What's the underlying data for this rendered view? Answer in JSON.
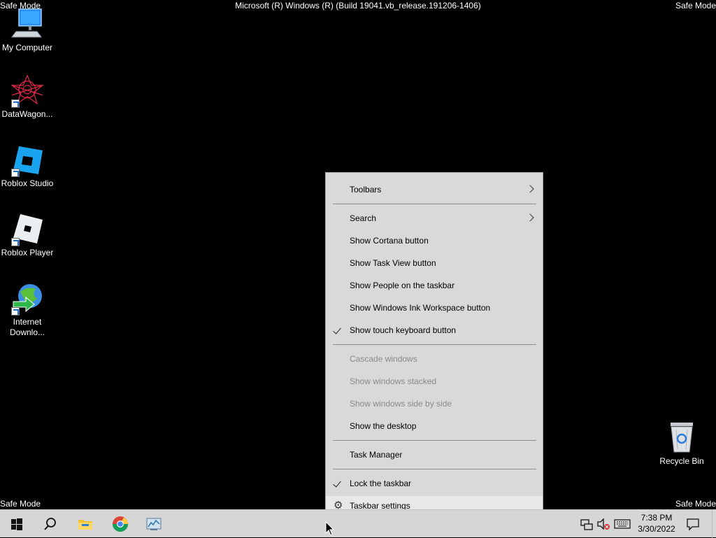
{
  "watermarks": {
    "top_left": "Safe Mode",
    "top_right": "Safe Mode",
    "bottom_left": "Safe Mode",
    "bottom_right": "Safe Mode",
    "build_title": "Microsoft (R) Windows (R) (Build 19041.vb_release.191206-1406)"
  },
  "desktop": {
    "icons": [
      {
        "label": "My Computer",
        "icon": "my-computer-icon"
      },
      {
        "label": "DataWagon...",
        "icon": "datawagon-icon"
      },
      {
        "label": "Roblox Studio",
        "icon": "roblox-studio-icon"
      },
      {
        "label": "Roblox Player",
        "icon": "roblox-player-icon"
      },
      {
        "label": "Internet Downlo...",
        "icon": "internet-download-manager-icon"
      },
      {
        "label": "Recycle Bin",
        "icon": "recycle-bin-icon"
      }
    ]
  },
  "context_menu": {
    "items": [
      {
        "label": "Toolbars",
        "submenu": true
      },
      {
        "label": "Search",
        "submenu": true
      },
      {
        "label": "Show Cortana button"
      },
      {
        "label": "Show Task View button"
      },
      {
        "label": "Show People on the taskbar"
      },
      {
        "label": "Show Windows Ink Workspace button"
      },
      {
        "label": "Show touch keyboard button",
        "checked": true
      },
      {
        "label": "Cascade windows",
        "disabled": true
      },
      {
        "label": "Show windows stacked",
        "disabled": true
      },
      {
        "label": "Show windows side by side",
        "disabled": true
      },
      {
        "label": "Show the desktop"
      },
      {
        "label": "Task Manager"
      },
      {
        "label": "Lock the taskbar",
        "checked": true
      },
      {
        "label": "Taskbar settings",
        "icon": "gear-icon",
        "hovered": true
      }
    ]
  },
  "taskbar": {
    "buttons": [
      "start-button",
      "search-button",
      "file-explorer-button",
      "chrome-button",
      "app-button"
    ],
    "clock": {
      "time": "7:38 PM",
      "date": "3/30/2022"
    }
  },
  "colors": {
    "desktop_bg": "#000000",
    "taskbar_bg": "#d6d6d6",
    "menu_bg": "#d9d9d9",
    "accent_blue": "#1e6fd1",
    "disabled_text": "#8a8a8a"
  }
}
